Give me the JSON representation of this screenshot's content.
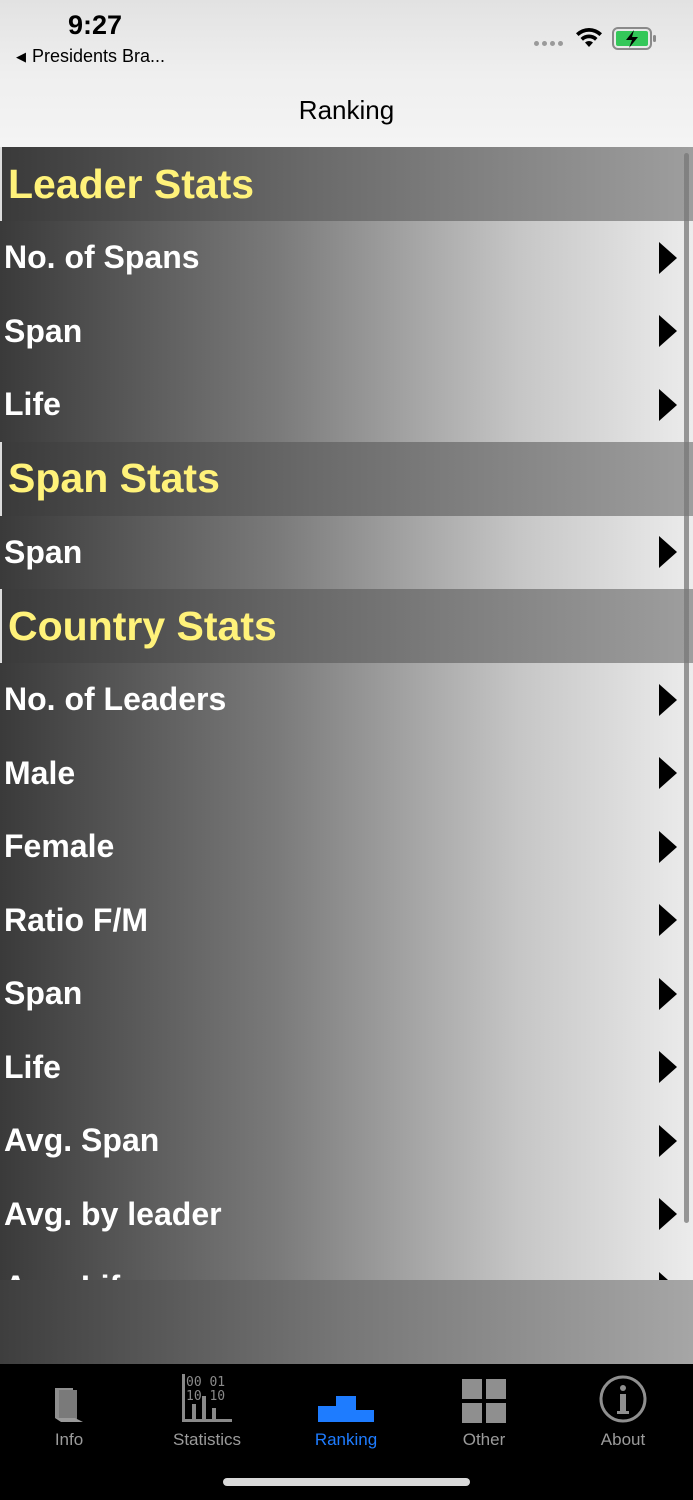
{
  "status": {
    "time": "9:27",
    "back_app": "Presidents Bra..."
  },
  "nav": {
    "title": "Ranking"
  },
  "sections": [
    {
      "header": "Leader Stats",
      "rows": [
        "No. of Spans",
        "Span",
        "Life"
      ]
    },
    {
      "header": "Span Stats",
      "rows": [
        "Span"
      ]
    },
    {
      "header": "Country Stats",
      "rows": [
        "No. of Leaders",
        "Male",
        "Female",
        "Ratio F/M",
        "Span",
        "Life",
        "Avg. Span",
        "Avg. by leader",
        "Avg. Life"
      ]
    }
  ],
  "tabs": [
    {
      "label": "Info",
      "icon": "book-icon",
      "active": false
    },
    {
      "label": "Statistics",
      "icon": "statistics-icon",
      "active": false
    },
    {
      "label": "Ranking",
      "icon": "podium-icon",
      "active": true
    },
    {
      "label": "Other",
      "icon": "grid-icon",
      "active": false
    },
    {
      "label": "About",
      "icon": "info-circle-icon",
      "active": false
    }
  ],
  "colors": {
    "header_text": "#fff27a",
    "active_tab": "#1e7cff",
    "inactive_tab": "#9b9b9b"
  }
}
